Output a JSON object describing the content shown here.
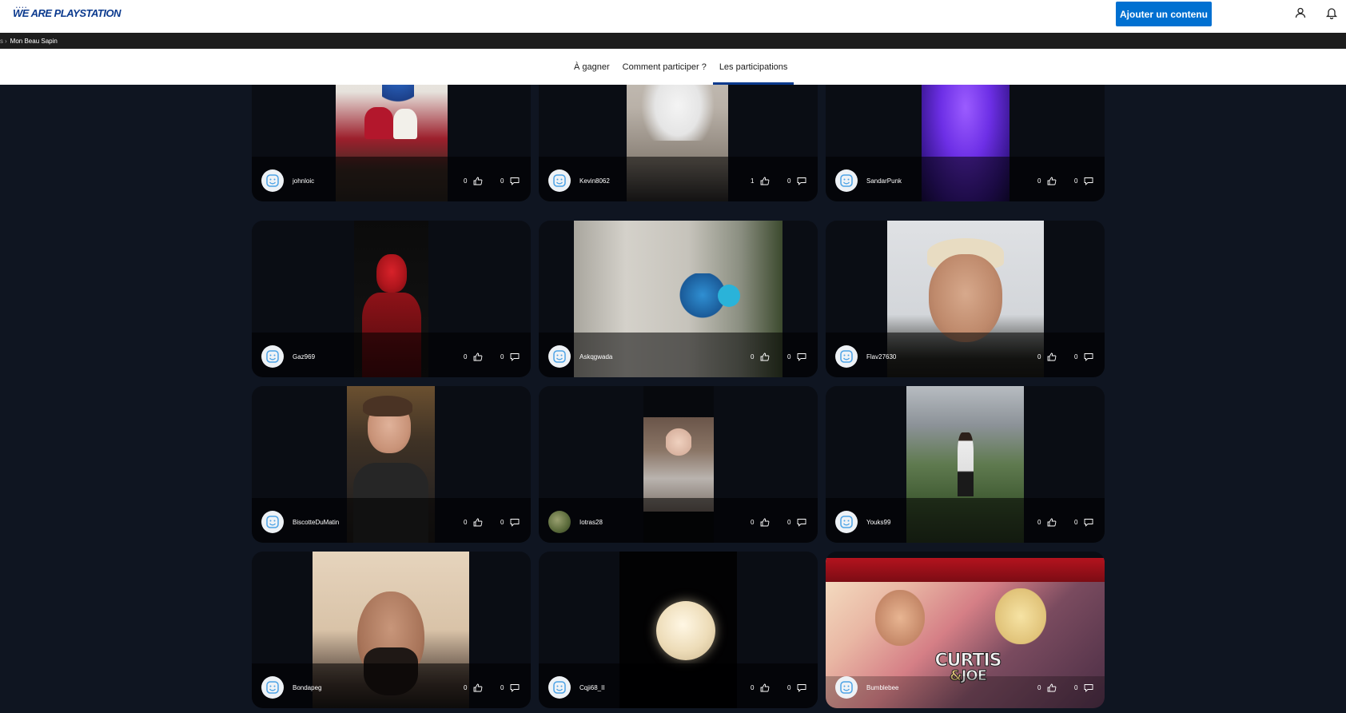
{
  "header": {
    "logo_text": "WE ARE PLAYSTATION",
    "cta_label": "Ajouter un contenu"
  },
  "breadcrumb": {
    "prev": "s",
    "current": "Mon Beau Sapin"
  },
  "tabs": [
    {
      "label": "À gagner"
    },
    {
      "label": "Comment participer ?"
    },
    {
      "label": "Les participations",
      "active": true
    }
  ],
  "entries": [
    {
      "username": "johnloic",
      "likes": "0",
      "comments": "0",
      "avatar": "robot-avatar"
    },
    {
      "username": "Kevin8062",
      "likes": "1",
      "comments": "0",
      "avatar": "robot-avatar"
    },
    {
      "username": "SandarPunk",
      "likes": "0",
      "comments": "0",
      "avatar": "robot-avatar"
    },
    {
      "username": "Gaz969",
      "likes": "0",
      "comments": "0",
      "avatar": "robot-avatar"
    },
    {
      "username": "Askqgwada",
      "likes": "0",
      "comments": "0",
      "avatar": "robot-avatar"
    },
    {
      "username": "Flav27630",
      "likes": "0",
      "comments": "0",
      "avatar": "robot-avatar"
    },
    {
      "username": "BiscotteDuMatin",
      "likes": "0",
      "comments": "0",
      "avatar": "robot-avatar"
    },
    {
      "username": "Iotras28",
      "likes": "0",
      "comments": "0",
      "avatar": "photo-avatar"
    },
    {
      "username": "Youks99",
      "likes": "0",
      "comments": "0",
      "avatar": "robot-avatar"
    },
    {
      "username": "Bondapeg",
      "likes": "0",
      "comments": "0",
      "avatar": "robot-avatar"
    },
    {
      "username": "Cqji68_II",
      "likes": "0",
      "comments": "0",
      "avatar": "robot-avatar"
    },
    {
      "username": "Bumblebee",
      "likes": "0",
      "comments": "0",
      "avatar": "robot-avatar"
    }
  ],
  "artwork_text": [
    "CURTIS",
    "&",
    "JOE"
  ],
  "colors": {
    "brand_blue": "#0070d1",
    "logo_blue": "#0b3a8e",
    "page_bg": "#0f1521",
    "card_bg": "#0a0d14"
  },
  "icons": [
    "user-icon",
    "bell-icon",
    "thumbs-up-icon",
    "comment-icon",
    "robot-avatar-icon"
  ]
}
